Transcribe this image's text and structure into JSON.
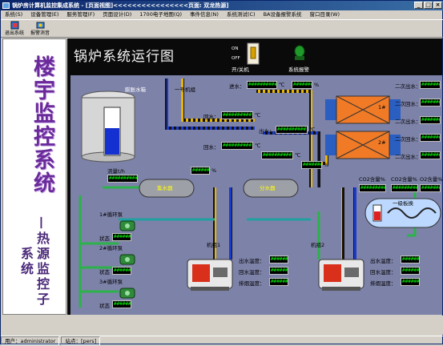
{
  "window": {
    "title": "锅炉房计算机监控集成系统 - [页面视图]<<<<<<<<<<<<<<<<页面: 双龙热源]",
    "minimize": "_",
    "maximize": "□",
    "close": "×"
  },
  "menu": [
    "系统(S)",
    "设备管理(E)",
    "服务管理(F)",
    "页面设计(D)",
    "1700电子地图(Q)",
    "事件信息(N)",
    "系统测试(C)",
    "BA设备报警系统",
    "窗口目录(W)"
  ],
  "toolbar": [
    {
      "label": "退出系统",
      "icon": "exit-icon"
    },
    {
      "label": "报警消音",
      "icon": "alarm-mute-icon"
    }
  ],
  "left_title": "楼宇监控系统",
  "left_subtitle": "—热源监控子系统",
  "main": {
    "title": "锅炉系统运行图",
    "switch_on": "ON",
    "switch_off": "OFF",
    "switch_label": "开/关机",
    "alarm_label": "系统报警",
    "tank_label": "膨胀水箱",
    "unit1_label": "一号机组",
    "unit2_label": "机组2",
    "boiler1_label": "机组1",
    "boiler2_label": "机组2",
    "collector1": "集水器",
    "collector2": "分水器",
    "makeup_label": "流量t/h",
    "percent": "%",
    "pump_labels": [
      "1#循环泵",
      "2#循环泵",
      "3#循环泵"
    ],
    "state_label": "状态",
    "co2_1": "CO2含量%",
    "co2_2": "CO2含量%",
    "o2": "O2含量%",
    "hx_label": "一级板换",
    "hx1_tag": "1#",
    "hx2_tag": "2#",
    "supply_water": "进水：",
    "return_water": "回水：",
    "out_water": "出水：",
    "second_out": "二次出水：",
    "second_back": "二次回水：",
    "degC": "℃",
    "boiler_rows": [
      "出水温度：",
      "回水温度：",
      "排烟温度："
    ],
    "value_placeholder": "##########"
  },
  "status": {
    "user": "用户：administrator",
    "site": "站点：[pers]"
  }
}
